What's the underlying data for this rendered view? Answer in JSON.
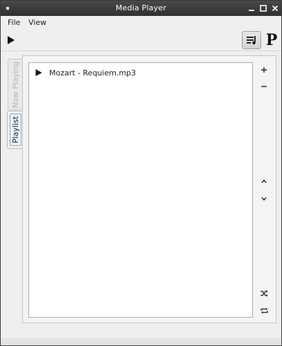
{
  "window": {
    "title": "Media Player"
  },
  "menubar": {
    "items": [
      "File",
      "View"
    ]
  },
  "toolbar": {
    "logo_letter": "P"
  },
  "tabs": {
    "now_playing": "Now Playing",
    "playlist": "Playlist",
    "active": "Playlist"
  },
  "playlist": {
    "items": [
      {
        "title": "Mozart - Requiem.mp3"
      }
    ]
  },
  "icons": {
    "play": "play-icon",
    "queue": "playlist-queue-icon",
    "add": "plus-icon",
    "remove": "minus-icon",
    "up": "chevron-up-icon",
    "down": "chevron-down-icon",
    "shuffle": "shuffle-icon",
    "repeat": "repeat-icon"
  },
  "colors": {
    "titlebar": "#2f2f2f",
    "window_bg": "#efefef",
    "tab_focus": "#7da7d6"
  }
}
